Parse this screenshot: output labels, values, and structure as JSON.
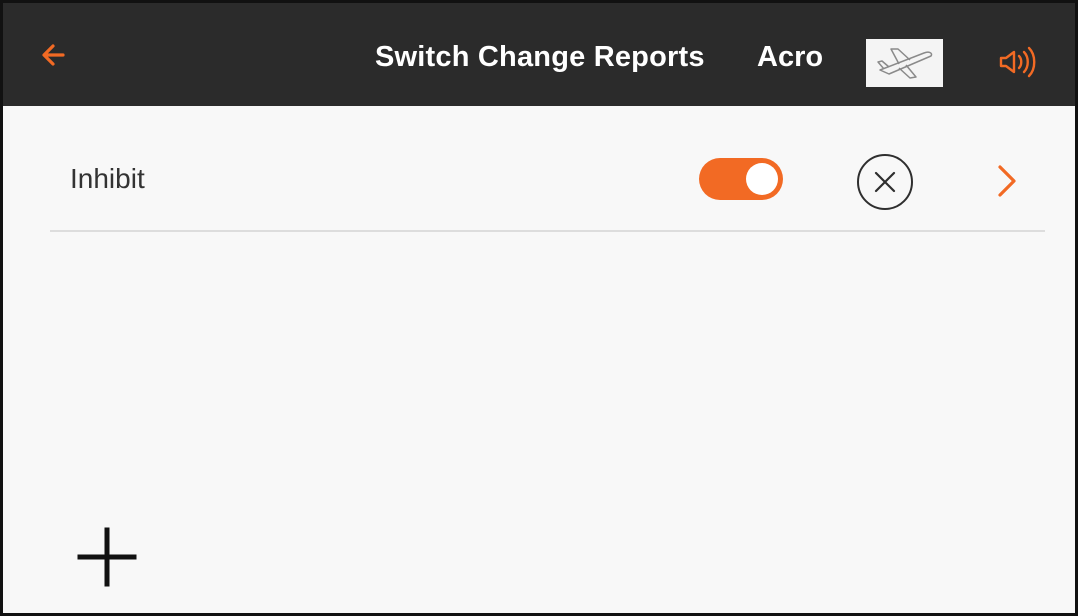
{
  "header": {
    "title": "Switch Change Reports",
    "model_name": "Acro",
    "back_icon": "arrow-left-icon",
    "model_icon": "airplane-icon",
    "audio_icon": "speaker-icon"
  },
  "rows": [
    {
      "label": "Inhibit",
      "toggle_on": true,
      "delete_icon": "circle-x-icon",
      "detail_icon": "chevron-right-icon"
    }
  ],
  "footer": {
    "add_icon": "plus-icon"
  },
  "colors": {
    "accent": "#f26a24",
    "header_bg": "#2b2b2b",
    "content_bg": "#f8f8f8",
    "text": "#333333",
    "divider": "#dddddd"
  }
}
